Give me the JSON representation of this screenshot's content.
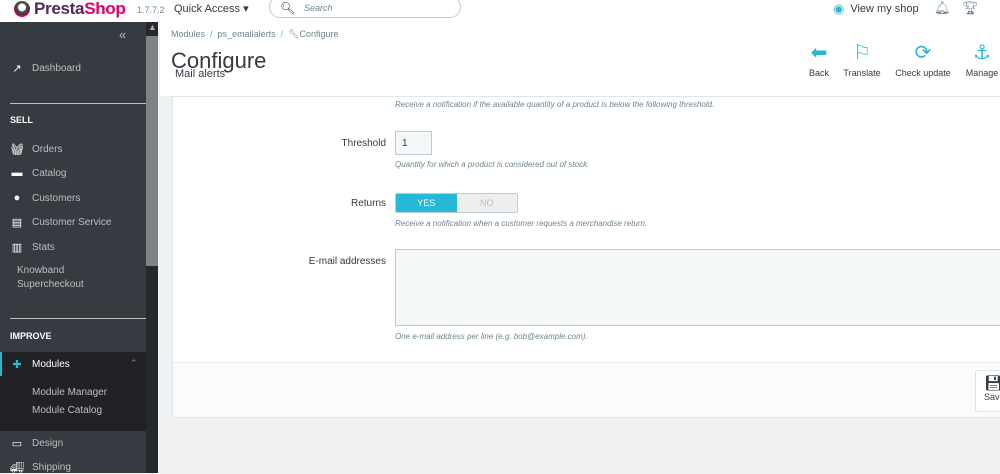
{
  "topbar": {
    "brand_a": "Presta",
    "brand_b": "Shop",
    "version": "1.7.7.2",
    "quick_access": "Quick Access ▾",
    "search_placeholder": "Search",
    "view_shop": "View my shop"
  },
  "sidebar": {
    "dashboard": "Dashboard",
    "sell_heading": "SELL",
    "sell_items": [
      "Orders",
      "Catalog",
      "Customers",
      "Customer Service",
      "Stats"
    ],
    "knowband": [
      "Knowband",
      "Supercheckout"
    ],
    "improve_heading": "IMPROVE",
    "modules": "Modules",
    "modules_sub": [
      "Module Manager",
      "Module Catalog"
    ],
    "design": "Design",
    "shipping": "Shipping"
  },
  "header": {
    "breadcrumb": [
      "Modules",
      "ps_emailalerts",
      "Configure"
    ],
    "title": "Configure",
    "subtitle": "Mail alerts",
    "toolbar": [
      {
        "label": "Back"
      },
      {
        "label": "Translate"
      },
      {
        "label": "Check update"
      },
      {
        "label": "Manage"
      }
    ]
  },
  "form": {
    "top_help": "Receive a notification if the available quantity of a product is below the following threshold.",
    "threshold_label": "Threshold",
    "threshold_value": "1",
    "threshold_help": "Quantity for which a product is considered out of stock.",
    "returns_label": "Returns",
    "yes": "YES",
    "no": "NO",
    "returns_help": "Receive a notification when a customer requests a merchandise return.",
    "email_label": "E-mail addresses",
    "email_value": "",
    "email_help": "One e-mail address per line (e.g. bob@example.com).",
    "save": "Save"
  },
  "colors": {
    "accent": "#25b9d7",
    "sidebar": "#363a41"
  }
}
